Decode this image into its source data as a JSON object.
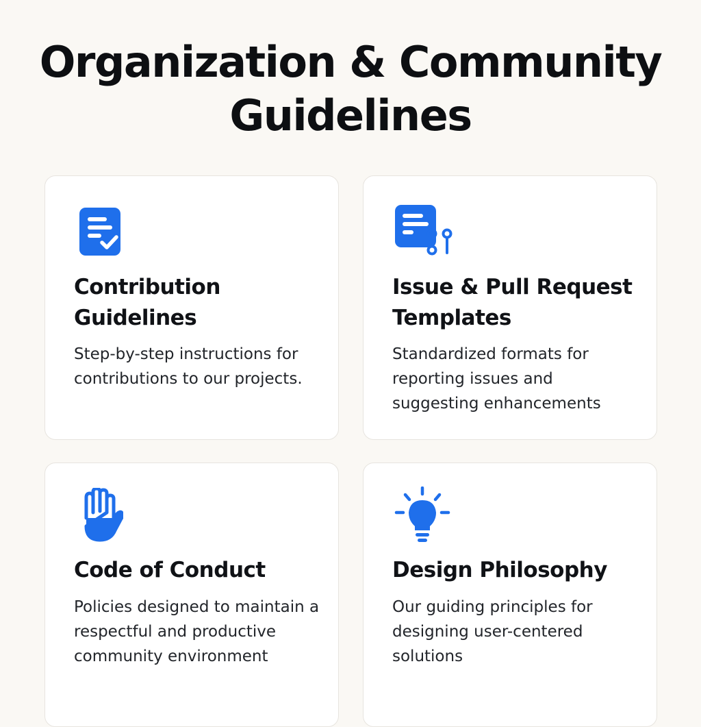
{
  "page": {
    "title": "Organization & Community Guidelines"
  },
  "colors": {
    "accent": "#1f6feb",
    "background": "#faf8f4",
    "card": "#ffffff",
    "card_border": "#e7e4df",
    "text": "#101216"
  },
  "cards": [
    {
      "icon": "document-check-icon",
      "title": "Contribution Guidelines",
      "description": "Step-by-step instructions for contributions to our projects."
    },
    {
      "icon": "pull-request-template-icon",
      "title": "Issue & Pull Request Templates",
      "description": "Standardized formats for reporting issues and suggesting enhancements"
    },
    {
      "icon": "raised-hand-icon",
      "title": "Code of Conduct",
      "description": "Policies designed to maintain a respectful and productive community environment"
    },
    {
      "icon": "lightbulb-icon",
      "title": "Design Philosophy",
      "description": "Our guiding principles for designing user-centered solutions"
    }
  ]
}
